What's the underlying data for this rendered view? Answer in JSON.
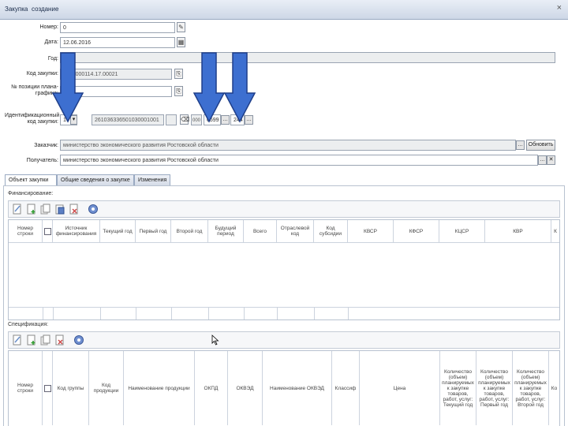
{
  "window": {
    "title": "Закупка",
    "subtitle": "создание",
    "close": "×"
  },
  "form": {
    "number": {
      "label": "Номер:",
      "value": "0"
    },
    "date": {
      "label": "Дата:",
      "value": "12.06.2016"
    },
    "year": {
      "label": "Год:",
      "value": ""
    },
    "purchase_code": {
      "label": "Код закупки:",
      "value": "1582000114.17.00021"
    },
    "plan_position": {
      "label": "№ позиции плана-графика:",
      "value": ""
    },
    "ident_code": {
      "label": "Идентификационный код закупки:",
      "year_value": "17",
      "code_value": "261036336501030001001",
      "small1": "",
      "small2": "000",
      "okpd_value": "0599",
      "kvr_value": "244"
    },
    "customer": {
      "label": "Заказчик:",
      "value": "министерство экономического развития Ростовской области",
      "refresh_label": "Обновить"
    },
    "recipient": {
      "label": "Получатель:",
      "value": "министерство экономического развития Ростовской области"
    }
  },
  "tabs": [
    {
      "label": "Объект закупки"
    },
    {
      "label": "Общие сведения о закупке"
    },
    {
      "label": "Изменения"
    }
  ],
  "financing": {
    "title": "Финансирование:",
    "columns": [
      "Номер строки",
      "",
      "Источник финансирования",
      "Текущий год",
      "Первый год",
      "Второй год",
      "Будущий период",
      "Всего",
      "Отраслевой код",
      "Код субсидии",
      "КВСР",
      "КФСР",
      "КЦСР",
      "КВР",
      "К"
    ]
  },
  "specification": {
    "title": "Спецификация:",
    "columns": [
      "Номер строки",
      "",
      "Код группы",
      "Код продукции",
      "Наименование продукции",
      "ОКПД",
      "ОКВЭД",
      "Наименование ОКВЭД",
      "Классиф",
      "Цена",
      "Количество (объем) планируемых к закупке товаров, работ, услуг: Текущий год",
      "Количество (объем) планируемых к закупке товаров, работ, услуг: Первый год",
      "Количество (объем) планируемых к закупке товаров, работ, услуг: Второй год",
      "Ко"
    ]
  },
  "icons": [
    "edit-icon",
    "add-icon",
    "copy-icon",
    "paste-icon",
    "delete-icon",
    "settings-icon",
    "calendar-icon",
    "clear-icon"
  ],
  "colors": {
    "arrow": "#3d6fd0",
    "arrow_border": "#1f3f8a",
    "titlebar": "#d8e0ec"
  }
}
